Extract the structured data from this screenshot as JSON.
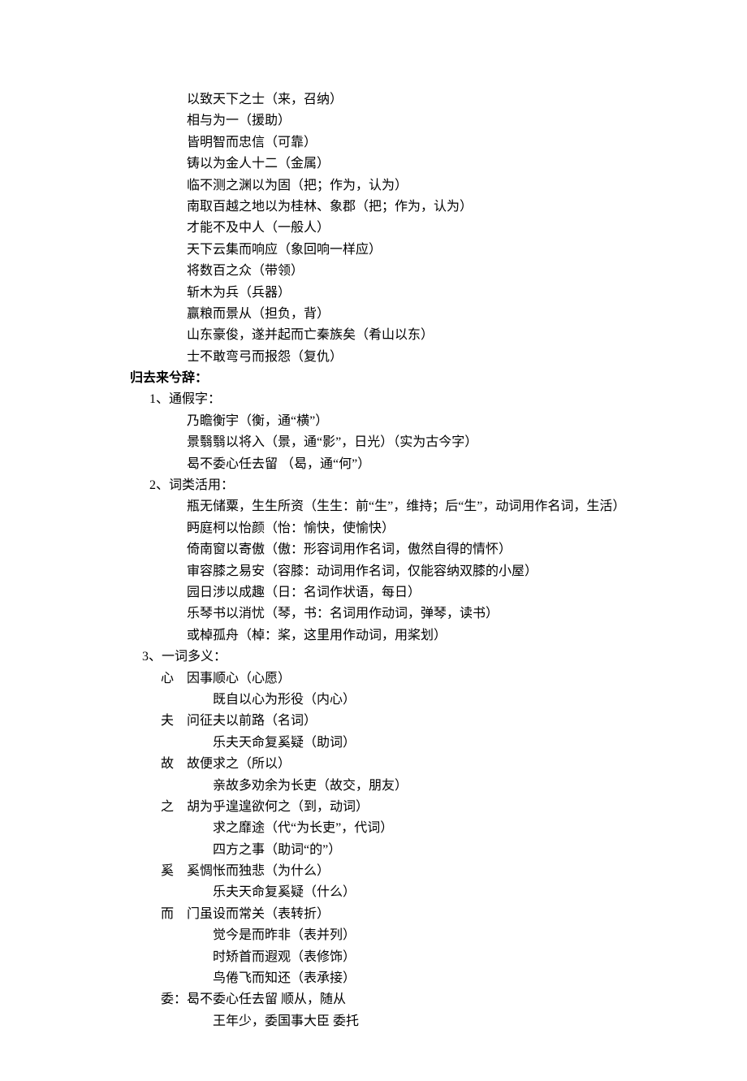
{
  "top_lines": [
    "以致天下之士（来，召纳）",
    "相与为一（援助）",
    "皆明智而忠信（可靠）",
    "铸以为金人十二（金属）",
    "临不测之渊以为固（把；作为，认为）",
    "南取百越之地以为桂林、象郡（把；作为，认为）",
    "才能不及中人（一般人）",
    "天下云集而响应（象回响一样应）",
    "将数百之众（带领）",
    "斩木为兵（兵器）",
    "赢粮而景从（担负，背）",
    "山东豪俊，遂并起而亡秦族矣（肴山以东）",
    "士不敢弯弓而报怨（复仇）"
  ],
  "title2": "归去来兮辞：",
  "sec1": {
    "head": "1、通假字：",
    "lines": [
      "乃瞻衡宇（衡，通“横”）",
      "景翳翳以将入（景，通“影”，日光）（实为古今字）",
      "曷不委心任去留 （曷，通“何”）"
    ]
  },
  "sec2": {
    "head": "2、词类活用：",
    "lines": [
      "瓶无储粟，生生所资（生生：前“生”，维持；后“生”，动词用作名词，生活）",
      "眄庭柯以怡颜（怡：愉快，使愉快）",
      "倚南窗以寄傲（傲：形容词用作名词，傲然自得的情怀）",
      "审容膝之易安（容膝：动词用作名词，仅能容纳双膝的小屋）",
      "园日涉以成趣（日：名词作状语，每日）",
      "乐琴书以消忧（琴，书：名词用作动词，弹琴，读书）",
      "或棹孤舟（棹：桨，这里用作动词，用桨划）"
    ]
  },
  "sec3": {
    "head": "3、一词多义：",
    "items": [
      {
        "key": "心",
        "first": "因事顺心（心愿）",
        "subs": [
          "既自以心为形役（内心）"
        ]
      },
      {
        "key": "夫",
        "first": "问征夫以前路（名词）",
        "subs": [
          "乐夫天命复奚疑（助词）"
        ]
      },
      {
        "key": "故",
        "first": "故便求之（所以）",
        "subs": [
          "亲故多劝余为长吏（故交，朋友）"
        ]
      },
      {
        "key": "之",
        "first": "胡为乎遑遑欲何之（到，动词）",
        "subs": [
          "求之靡途（代“为长吏”，代词）",
          "四方之事（助词“的”）"
        ]
      },
      {
        "key": "奚",
        "first": "奚惆怅而独悲（为什么）",
        "subs": [
          "乐夫天命复奚疑（什么）"
        ]
      },
      {
        "key": "而",
        "first": "门虽设而常关（表转折）",
        "subs": [
          "觉今是而昨非（表并列）",
          "时矫首而遐观（表修饰）",
          "鸟倦飞而知还（表承接）"
        ]
      },
      {
        "key": "委：",
        "first": "曷不委心任去留 顺从，随从",
        "subs": [
          "王年少，委国事大臣 委托"
        ]
      }
    ]
  }
}
